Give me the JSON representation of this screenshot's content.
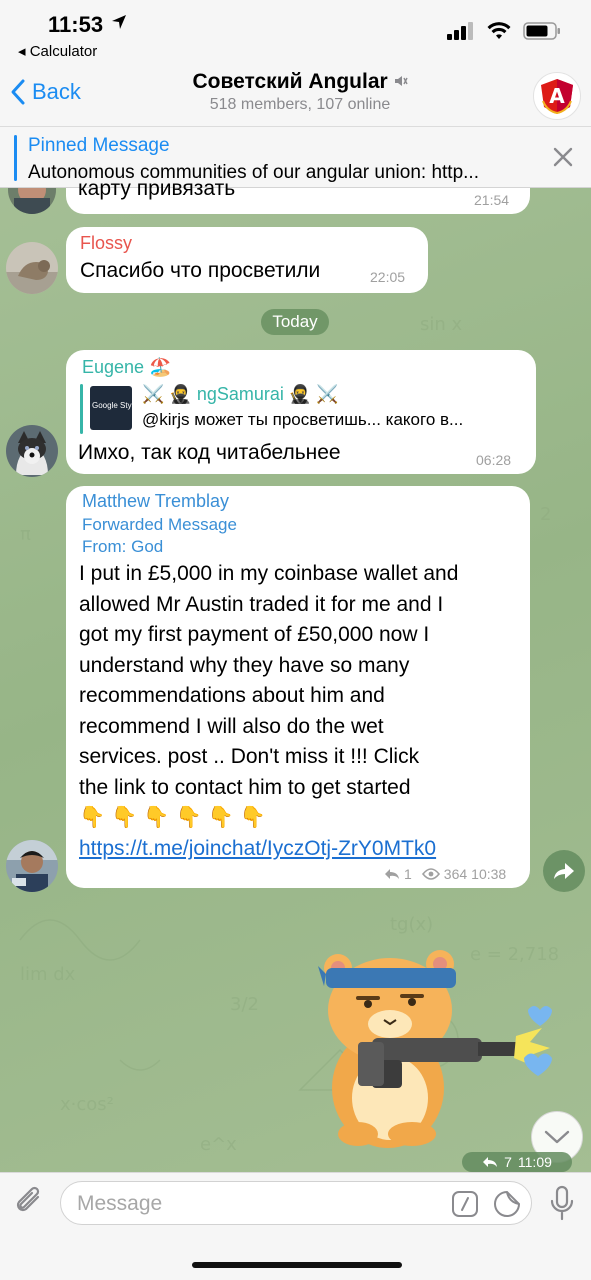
{
  "status_bar": {
    "time": "11:53",
    "back_app": "Calculator"
  },
  "header": {
    "back_label": "Back",
    "title": "Советский Angular",
    "subtitle": "518 members, 107 online",
    "avatar_letter": "A"
  },
  "pinned": {
    "title": "Pinned Message",
    "text": "Autonomous communities of our angular union: http..."
  },
  "messages": [
    {
      "text": "карту привязать",
      "time": "21:54"
    },
    {
      "sender": "Flossy",
      "text": "Спасибо что просветили",
      "time": "22:05"
    },
    {
      "date": "Today"
    },
    {
      "sender": "Eugene 🏖️",
      "reply_author": "⚔️ 🥷 ngSamurai 🥷 ⚔️",
      "reply_text": "@kirjs может ты просветишь... какого в...",
      "reply_thumb": "Google Style",
      "text": "Имхо, так код читабельнее",
      "time": "06:28"
    },
    {
      "sender": "Matthew Tremblay",
      "forwarded": "Forwarded Message",
      "from": "From: God",
      "lines": [
        "I put in £5,000  in my coinbase wallet and",
        "allowed Mr Austin traded it for me and I",
        "got my first payment of £50,000  now I",
        "understand why they have so many",
        "recommendations about him and",
        "recommend I will also do the wet",
        "services.   post .. Don't miss it !!!  Click",
        "the link to contact him to get started",
        "👇👇👇👇👇👇"
      ],
      "link": "https://t.me/joinchat/IyczOtj-ZrY0MTk0",
      "replies": "1",
      "views": "364",
      "time": "10:38"
    }
  ],
  "sticker": {
    "replies": "7",
    "time": "11:09"
  },
  "composer": {
    "placeholder": "Message"
  },
  "colors": {
    "accent": "#1b8cf2",
    "flossy": "#e8554e",
    "eugene": "#36b5a8",
    "matthew": "#3a8fd6",
    "chat_bg": "#9fba8e"
  }
}
